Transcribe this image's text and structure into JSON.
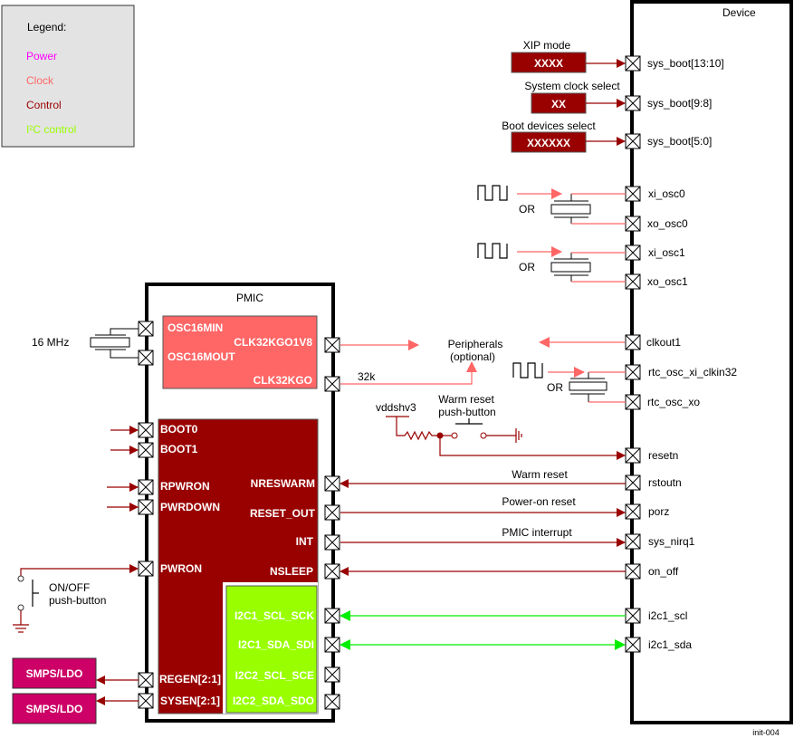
{
  "colors": {
    "power": "#ff00ff",
    "clock": "#ff6666",
    "control": "#990000",
    "i2c": "#99ff00",
    "i2c_line": "#00ee00",
    "smps": "#cc0066",
    "legend_bg": "#e3e3e3"
  },
  "legend": {
    "title": "Legend:",
    "items": [
      {
        "label": "Power",
        "color": "#ff00ff"
      },
      {
        "label": "Clock",
        "color": "#ff6666"
      },
      {
        "label": "Control",
        "color": "#990000"
      },
      {
        "label": "I²C control",
        "color": "#99ff00"
      }
    ]
  },
  "device": {
    "title": "Device",
    "pins": [
      "sys_boot[13:10]",
      "sys_boot[9:8]",
      "sys_boot[5:0]",
      "xi_osc0",
      "xo_osc0",
      "xi_osc1",
      "xo_osc1",
      "clkout1",
      "rtc_osc_xi_clkin32",
      "rtc_osc_xo",
      "resetn",
      "rstoutn",
      "porz",
      "sys_nirq1",
      "on_off",
      "i2c1_scl",
      "i2c1_sda"
    ]
  },
  "boot_config": [
    {
      "caption": "XIP mode",
      "value": "XXXX"
    },
    {
      "caption": "System clock select",
      "value": "XX"
    },
    {
      "caption": "Boot devices select",
      "value": "XXXXXX"
    }
  ],
  "pmic": {
    "title": "PMIC",
    "clock_block": {
      "left_pins": [
        "OSC16MIN",
        "OSC16MOUT"
      ],
      "right_pins": [
        "CLK32KGO1V8",
        "CLK32KGO"
      ]
    },
    "control_block": {
      "left_pins": [
        "BOOT0",
        "BOOT1",
        "RPWRON",
        "PWRDOWN",
        "PWRON",
        "REGEN[2:1]",
        "SYSEN[2:1]"
      ],
      "right_pins": [
        "NRESWARM",
        "RESET_OUT",
        "INT",
        "NSLEEP"
      ]
    },
    "i2c_block": {
      "pins": [
        "I2C1_SCL_SCK",
        "I2C1_SDA_SDI",
        "I2C2_SCL_SCE",
        "I2C2_SDA_SDO"
      ]
    }
  },
  "labels": {
    "crystal_16mhz": "16 MHz",
    "or": "OR",
    "peripherals": "Peripherals",
    "optional": "(optional)",
    "k32": "32k",
    "vddshv3": "vddshv3",
    "warm_reset_btn_1": "Warm reset",
    "warm_reset_btn_2": "push-button",
    "warm_reset": "Warm reset",
    "power_on_reset": "Power-on reset",
    "pmic_interrupt": "PMIC interrupt",
    "onoff_1": "ON/OFF",
    "onoff_2": "push-button",
    "smps_ldo": "SMPS/LDO",
    "figure_id": "init-004"
  }
}
